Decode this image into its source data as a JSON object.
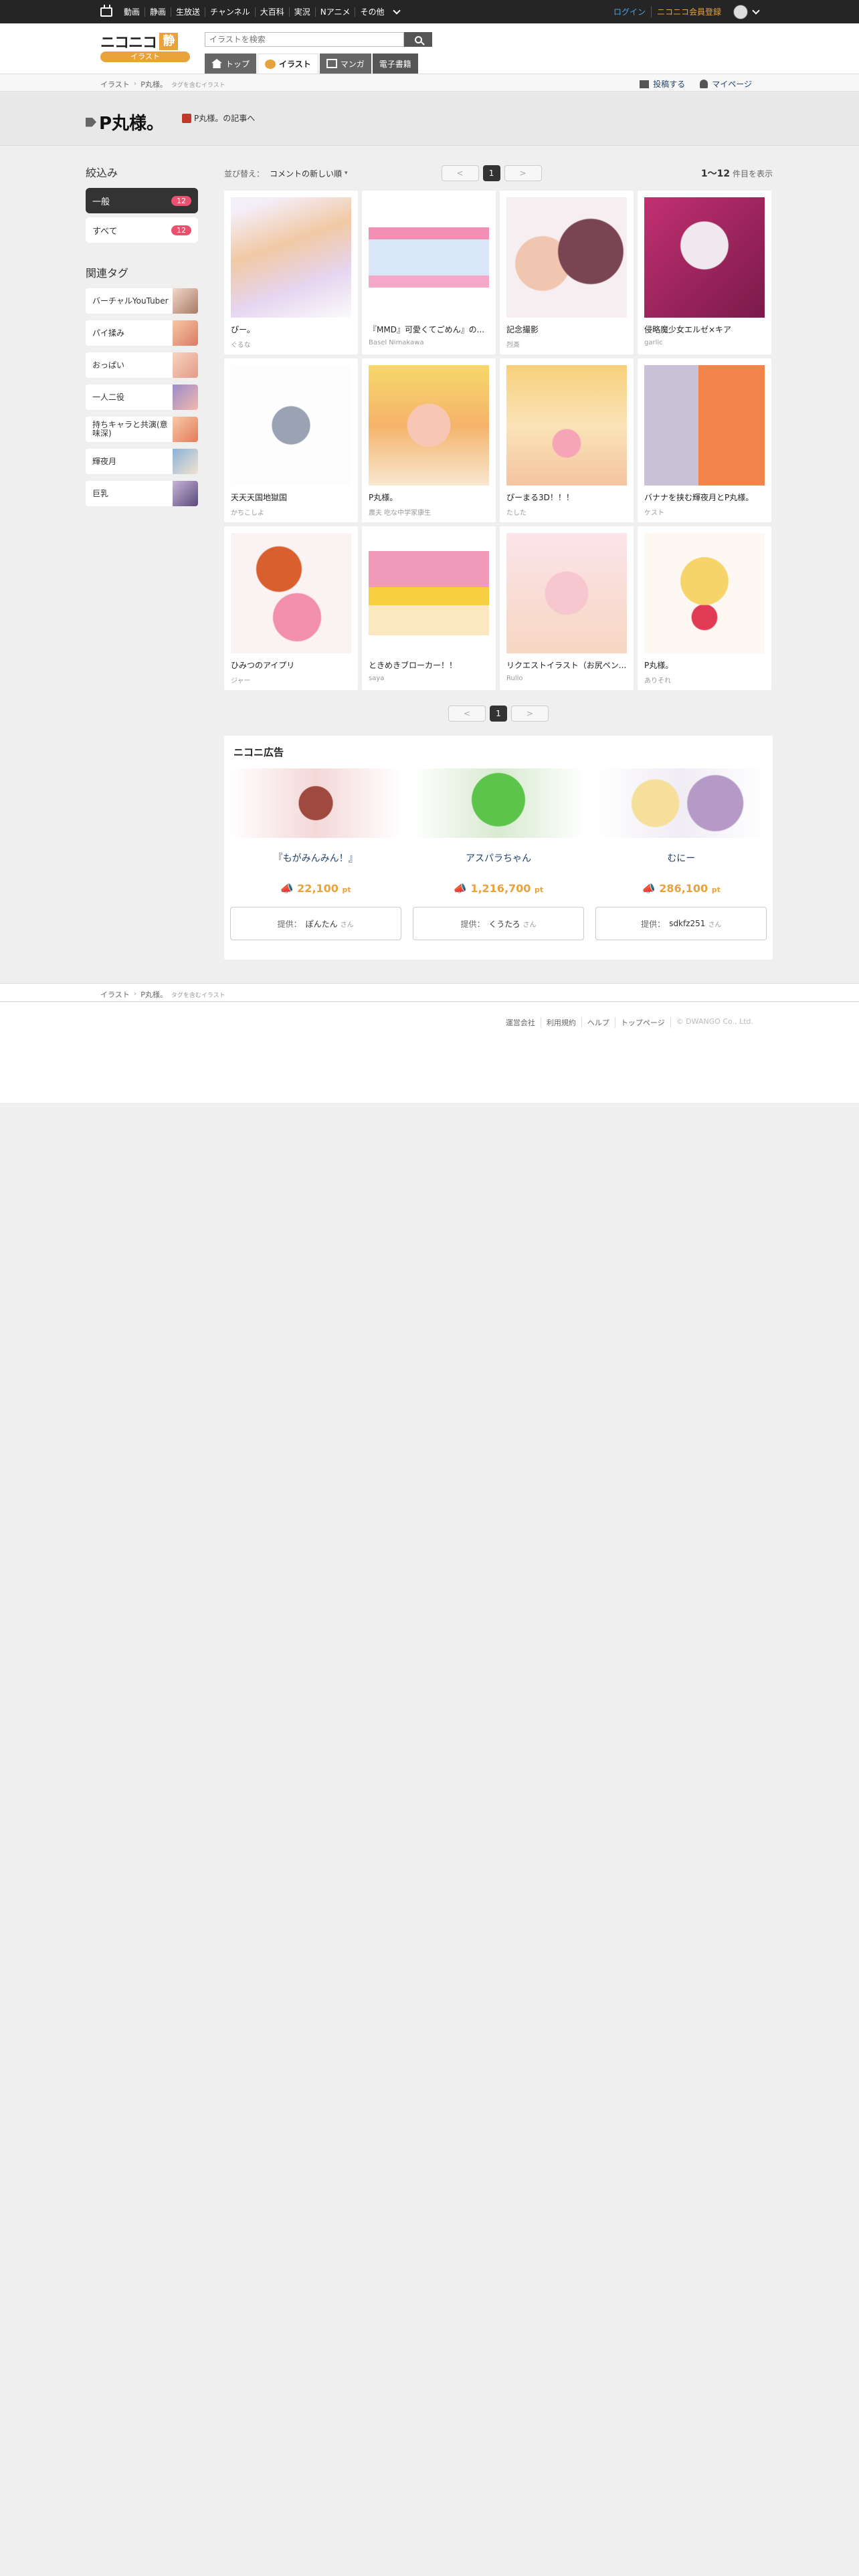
{
  "gnav": {
    "links": [
      "動画",
      "静画",
      "生放送",
      "チャンネル",
      "大百科",
      "実況",
      "Nアニメ",
      "その他"
    ],
    "login": "ログイン",
    "register": "ニコニコ会員登録"
  },
  "header": {
    "logo_text": "ニコニコ",
    "logo_kanji": "静",
    "logo_sub": "イラスト",
    "search_placeholder": "イラストを検索",
    "tabs": [
      {
        "label": "トップ"
      },
      {
        "label": "イラスト"
      },
      {
        "label": "マンガ"
      },
      {
        "label": "電子書籍"
      }
    ]
  },
  "breadcrumb": {
    "root": "イラスト",
    "current": "P丸様。",
    "note": "タグを含むイラスト"
  },
  "actions": {
    "post": "投稿する",
    "mypage": "マイページ"
  },
  "title": {
    "tag": "P丸様。",
    "dic_link": "P丸様。の記事へ"
  },
  "sidebar": {
    "filter_title": "絞込み",
    "filters": [
      {
        "label": "一般",
        "count": "12"
      },
      {
        "label": "すべて",
        "count": "12"
      }
    ],
    "related_title": "関連タグ",
    "related": [
      {
        "label": "バーチャルYouTuber"
      },
      {
        "label": "パイ揉み"
      },
      {
        "label": "おっぱい"
      },
      {
        "label": "一人二役"
      },
      {
        "label": "持ちキャラと共演(意味深)"
      },
      {
        "label": "輝夜月"
      },
      {
        "label": "巨乳"
      }
    ]
  },
  "sort": {
    "label": "並び替え：",
    "value": "コメントの新しい順"
  },
  "pager": {
    "prev": "<",
    "page": "1",
    "next": ">"
  },
  "result_count": {
    "range": "1〜12",
    "suffix": "件目を表示"
  },
  "illusts": [
    {
      "title": "ぴー。",
      "author": "ぐるな"
    },
    {
      "title": "『MMD』可愛くてごめん』の...",
      "author": "Basel Nimakawa"
    },
    {
      "title": "記念撮影",
      "author": "烈斎"
    },
    {
      "title": "侵略魔少女エルゼ×キア",
      "author": "garlic"
    },
    {
      "title": "天天天国地獄国",
      "author": "かちこしよ"
    },
    {
      "title": "P丸様。",
      "author": "農夫 吃な中学家康生"
    },
    {
      "title": "ぴーまる3D！！！",
      "author": "たした"
    },
    {
      "title": "バナナを挟む輝夜月とP丸様。",
      "author": "ケスト"
    },
    {
      "title": "ひみつのアイプリ",
      "author": "ジャー"
    },
    {
      "title": "ときめきブローカー！！",
      "author": "saya"
    },
    {
      "title": "リクエストイラスト（お尻ペン...",
      "author": "Rullo"
    },
    {
      "title": "P丸様。",
      "author": "ありそれ"
    }
  ],
  "ad": {
    "title": "ニコニ広告",
    "items": [
      {
        "name": "『もがみんみん！』",
        "points": "22,100",
        "unit": "pt",
        "provider_label": "提供：",
        "provider": "ぽんたん",
        "san": "さん"
      },
      {
        "name": "アスパラちゃん",
        "points": "1,216,700",
        "unit": "pt",
        "provider_label": "提供：",
        "provider": "くうたろ",
        "san": "さん"
      },
      {
        "name": "むにー",
        "points": "286,100",
        "unit": "pt",
        "provider_label": "提供：",
        "provider": "sdkfz251",
        "san": "さん"
      }
    ]
  },
  "footer": {
    "links": [
      "運営会社",
      "利用規約",
      "ヘルプ",
      "トップページ"
    ],
    "copyright": "© DWANGO Co., Ltd."
  }
}
